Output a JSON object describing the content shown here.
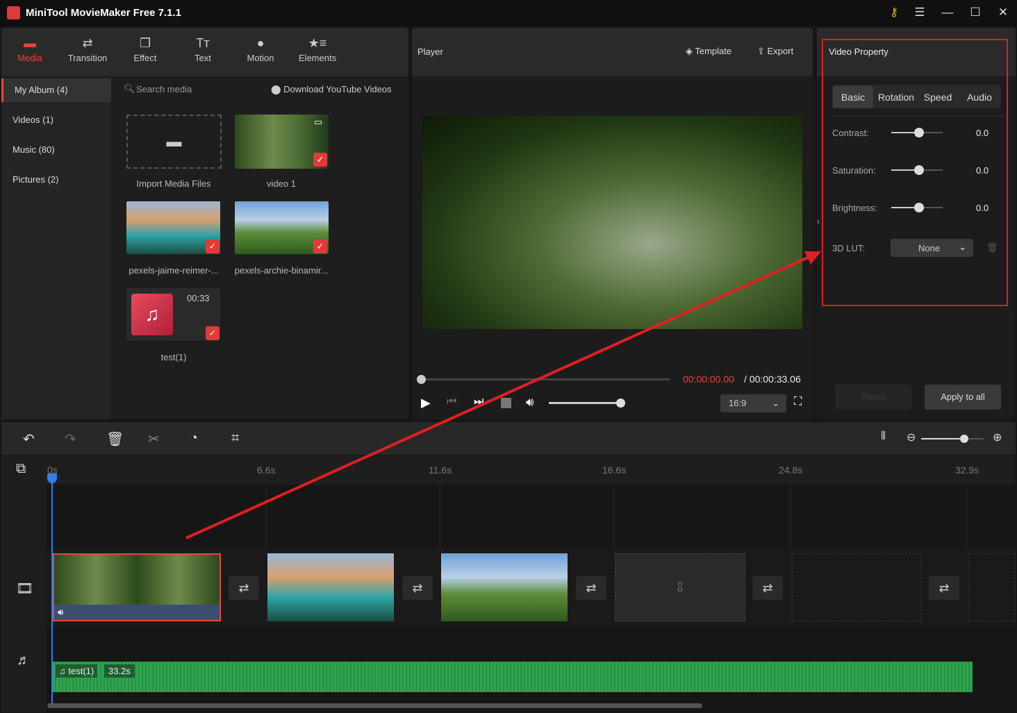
{
  "app": {
    "title": "MiniTool MovieMaker Free 7.1.1"
  },
  "window": {
    "key_icon": "key-icon",
    "menu": "☰",
    "minimize": "—",
    "maximize": "☐",
    "close": "✕"
  },
  "toolbar": [
    {
      "label": "Media",
      "icon": "folder-icon",
      "active": true
    },
    {
      "label": "Transition",
      "icon": "swap-icon"
    },
    {
      "label": "Effect",
      "icon": "layers-icon"
    },
    {
      "label": "Text",
      "icon": "text-icon"
    },
    {
      "label": "Motion",
      "icon": "motion-icon"
    },
    {
      "label": "Elements",
      "icon": "star-list-icon"
    }
  ],
  "sidebar": [
    {
      "label": "My Album (4)",
      "active": true
    },
    {
      "label": "Videos (1)"
    },
    {
      "label": "Music (80)"
    },
    {
      "label": "Pictures (2)"
    }
  ],
  "media": {
    "search_placeholder": "Search media",
    "download": "Download YouTube Videos",
    "items": [
      {
        "caption": "Import Media Files"
      },
      {
        "caption": "video 1"
      },
      {
        "caption": "pexels-jaime-reimer-..."
      },
      {
        "caption": "pexels-archie-binamir..."
      },
      {
        "caption": "test(1)",
        "duration": "00:33"
      }
    ]
  },
  "player": {
    "title": "Player",
    "template": "Template",
    "export": "Export",
    "current_time": "00:00:00.00",
    "total_time": "/ 00:00:33.06",
    "aspect": "16:9",
    "progress": 0,
    "volume": 1.0
  },
  "property": {
    "title": "Video Property",
    "tabs": [
      "Basic",
      "Rotation",
      "Speed",
      "Audio"
    ],
    "active_tab": "Basic",
    "rows": [
      {
        "label": "Contrast:",
        "value": "0.0"
      },
      {
        "label": "Saturation:",
        "value": "0.0"
      },
      {
        "label": "Brightness:",
        "value": "0.0"
      }
    ],
    "lut_label": "3D LUT:",
    "lut_value": "None",
    "reset": "Reset",
    "apply_all": "Apply to all"
  },
  "timeline": {
    "ticks": [
      "0s",
      "6.6s",
      "11.6s",
      "16.6s",
      "24.8s",
      "32.9s"
    ],
    "zoom_level": 0.85,
    "audio": {
      "name": "test(1)",
      "duration": "33.2s"
    }
  },
  "colors": {
    "accent": "#e8453c",
    "bg": "#222222",
    "audio": "#2ea44f",
    "highlight": "#e02020"
  }
}
